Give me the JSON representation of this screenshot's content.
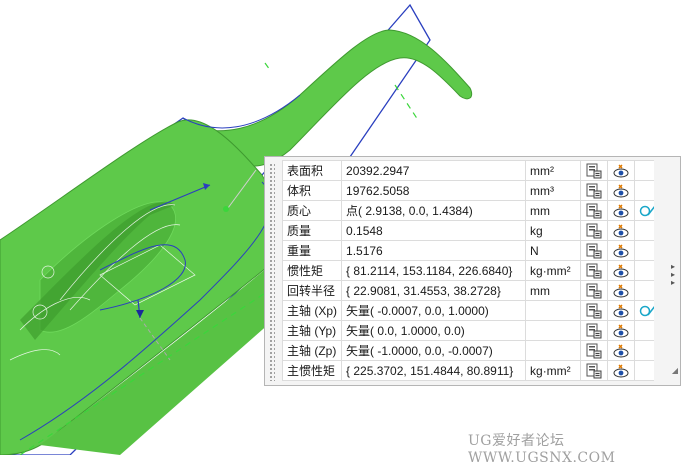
{
  "properties": [
    {
      "name": "表面积",
      "value": "20392.2947",
      "unit": "mm²",
      "extra": false
    },
    {
      "name": "体积",
      "value": "19762.5058",
      "unit": "mm³",
      "extra": false
    },
    {
      "name": "质心",
      "value": "点( 2.9138, 0.0, 1.4384)",
      "unit": "mm",
      "extra": true
    },
    {
      "name": "质量",
      "value": "0.1548",
      "unit": "kg",
      "extra": false
    },
    {
      "name": "重量",
      "value": "1.5176",
      "unit": "N",
      "extra": false
    },
    {
      "name": "惯性矩",
      "value": "{ 81.2114, 153.1184, 226.6840}",
      "unit": "kg·mm²",
      "extra": false
    },
    {
      "name": "回转半径",
      "value": "{ 22.9081, 31.4553, 38.2728}",
      "unit": "mm",
      "extra": false
    },
    {
      "name": "主轴 (Xp)",
      "value": "矢量( -0.0007, 0.0, 1.0000)",
      "unit": "",
      "extra": true
    },
    {
      "name": "主轴 (Yp)",
      "value": "矢量( 0.0, 1.0000, 0.0)",
      "unit": "",
      "extra": false
    },
    {
      "name": "主轴 (Zp)",
      "value": "矢量( -1.0000, 0.0, -0.0007)",
      "unit": "",
      "extra": false
    },
    {
      "name": "主惯性矩",
      "value": "{ 225.3702, 151.4844, 80.8911}",
      "unit": "kg·mm²",
      "extra": false
    }
  ],
  "icons": {
    "export": "export-to-spreadsheet-icon",
    "show": "show-in-graphics-icon",
    "extra": "vector-display-icon"
  },
  "colors": {
    "part_green": "#5ec94a",
    "edge_blue": "#2a3fbf",
    "accent_cyan": "#1aa7c9"
  },
  "watermark": "UG爱好者论坛 WWW.UGSNX.COM"
}
